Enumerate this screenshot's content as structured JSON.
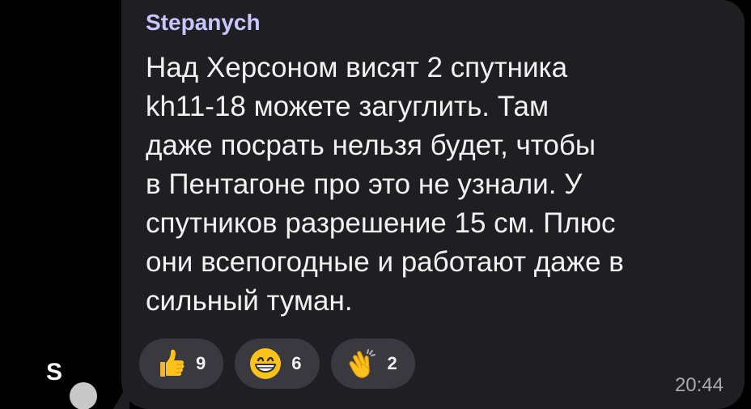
{
  "avatar": {
    "letter": "S"
  },
  "message": {
    "sender": "Stepanych",
    "lines": [
      "Над Херсоном висят 2 спутника",
      "kh11-18 можете загуглить. Там",
      "даже посрать нельзя будет, чтобы",
      "в Пентагоне про это не узнали. У",
      "спутников разрешение 15 см. Плюс",
      "они всепогодные и работают даже в",
      "сильный туман."
    ],
    "time": "20:44"
  },
  "reactions": [
    {
      "icon": "thumbs-up-icon",
      "count": "9"
    },
    {
      "icon": "grinning-face-icon",
      "count": "6"
    },
    {
      "icon": "clapping-hands-icon",
      "count": "2"
    }
  ],
  "colors": {
    "background": "#000000",
    "bubble": "#1f1f23",
    "sender_name": "#c9c6ff",
    "message_text": "#f2f2f2",
    "reaction_pill": "#3a3940",
    "timestamp": "#a8a8ad"
  }
}
